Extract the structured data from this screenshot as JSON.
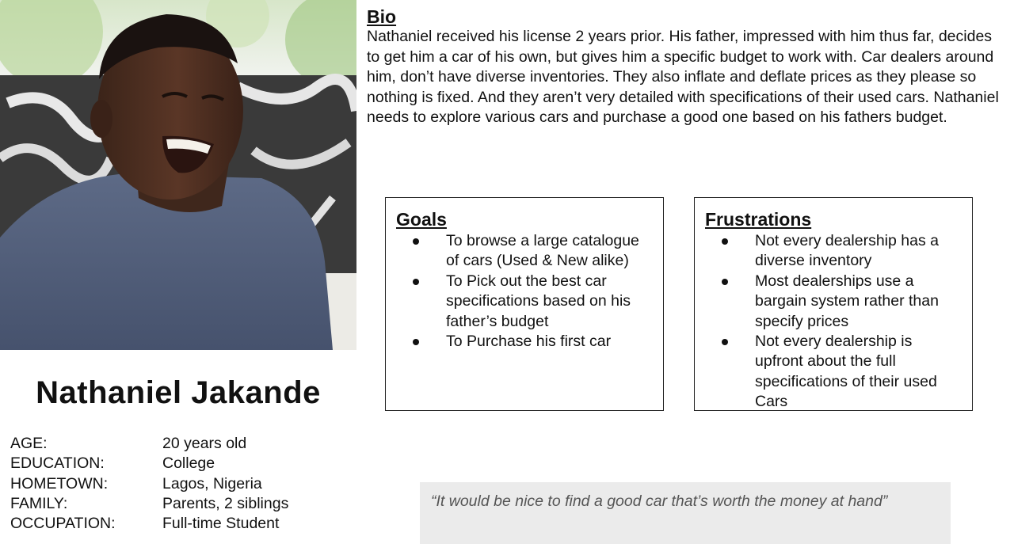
{
  "persona": {
    "name": "Nathaniel Jakande",
    "photo_alt": "Portrait photo"
  },
  "bio": {
    "heading": "Bio",
    "text": "Nathaniel received his license 2 years prior. His father, impressed with him thus far, decides to get him a car of his own, but gives him a specific budget to work with. Car dealers around him, don’t have diverse inventories. They also inflate and deflate prices as they please so nothing is fixed. And they aren’t very detailed with specifications of their used cars. Nathaniel needs to explore various cars and purchase a good one based on his fathers budget."
  },
  "goals": {
    "heading": "Goals",
    "items": [
      "To browse a large catalogue of cars (Used & New alike)",
      "To Pick out the best car specifications based on his father’s budget",
      "To Purchase his first car"
    ]
  },
  "frustrations": {
    "heading": "Frustrations",
    "items": [
      "Not every dealership has a diverse inventory",
      "Most dealerships use a bargain system rather than specify prices",
      "Not every dealership is upfront about the full specifications of their used Cars"
    ]
  },
  "info": [
    {
      "label": "AGE:",
      "value": "20 years old"
    },
    {
      "label": "EDUCATION:",
      "value": "College"
    },
    {
      "label": "HOMETOWN:",
      "value": "Lagos, Nigeria"
    },
    {
      "label": "FAMILY:",
      "value": "Parents, 2 siblings"
    },
    {
      "label": "OCCUPATION:",
      "value": "Full-time Student"
    }
  ],
  "quote": "“It would be nice to find a good car that’s worth the money at hand”"
}
